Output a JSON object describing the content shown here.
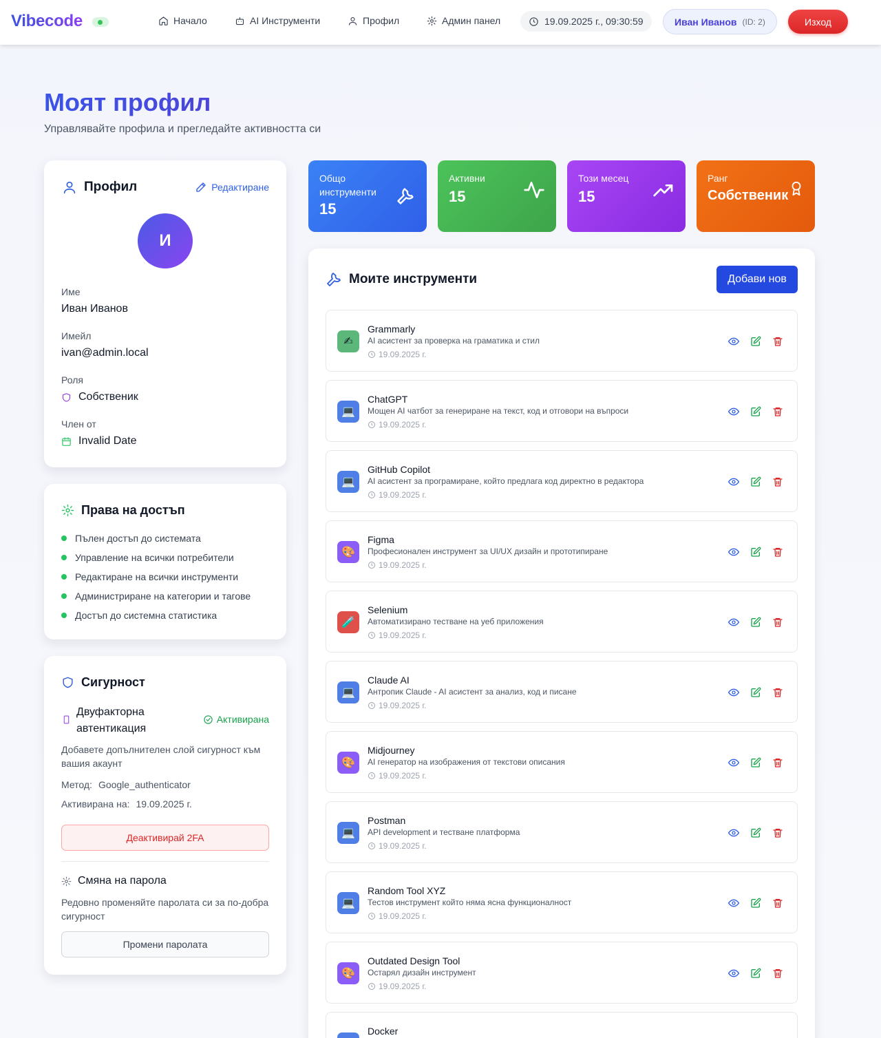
{
  "header": {
    "logo": "Vibecode",
    "nav": [
      {
        "label": "Начало",
        "icon": "home-icon"
      },
      {
        "label": "AI Инструменти",
        "icon": "robot-icon"
      },
      {
        "label": "Профил",
        "icon": "user-icon"
      },
      {
        "label": "Админ панел",
        "icon": "gear-icon"
      }
    ],
    "datetime": "19.09.2025 г., 09:30:59",
    "user_name": "Иван Иванов",
    "user_id": "(ID: 2)",
    "logout": "Изход"
  },
  "page": {
    "title": "Моят профил",
    "subtitle": "Управлявайте профила и прегледайте активността си"
  },
  "profile": {
    "title": "Профил",
    "edit": "Редактиране",
    "avatar_letter": "И",
    "name_label": "Име",
    "name": "Иван Иванов",
    "email_label": "Имейл",
    "email": "ivan@admin.local",
    "role_label": "Роля",
    "role": "Собственик",
    "member_label": "Член от",
    "member_since": "Invalid Date"
  },
  "permissions": {
    "title": "Права на достъп",
    "items": [
      "Пълен достъп до системата",
      "Управление на всички потребители",
      "Редактиране на всички инструменти",
      "Администриране на категории и тагове",
      "Достъп до системна статистика"
    ]
  },
  "security": {
    "title": "Сигурност",
    "twofa_title_line1": "Двуфакторна",
    "twofa_title_line2": "автентикация",
    "twofa_status": "Активирана",
    "twofa_desc": "Добавете допълнителен слой сигурност към вашия акаунт",
    "method_label": "Метод:",
    "method": "Google_authenticator",
    "activated_label": "Активирана на:",
    "activated": "19.09.2025 г.",
    "deactivate": "Деактивирай 2FA",
    "pw_title": "Смяна на парола",
    "pw_desc": "Редовно променяйте паролата си за по-добра сигурност",
    "pw_button": "Промени паролата"
  },
  "stats": [
    {
      "label": "Общо инструменти",
      "value": "15",
      "icon": "wrench-icon",
      "color": "#3b6ef6"
    },
    {
      "label": "Активни",
      "value": "15",
      "icon": "activity-icon",
      "color": "#45b553"
    },
    {
      "label": "Този месец",
      "value": "15",
      "icon": "trending-up-icon",
      "color": "#9b3cf0"
    },
    {
      "label": "Ранг",
      "value": "Собственик",
      "icon": "award-icon",
      "color": "#ef6a14"
    }
  ],
  "tools_section": {
    "title": "Моите инструменти",
    "add": "Добави нов",
    "tools": [
      {
        "name": "Grammarly",
        "desc": "AI асистент за проверка на граматика и стил",
        "date": "19.09.2025 г.",
        "icon": "✍",
        "icon_bg": "#5cb87a"
      },
      {
        "name": "ChatGPT",
        "desc": "Мощен AI чатбот за генериране на текст, код и отговори на въпроси",
        "date": "19.09.2025 г.",
        "icon": "💻",
        "icon_bg": "#4f7fe6"
      },
      {
        "name": "GitHub Copilot",
        "desc": "AI асистент за програмиране, който предлага код директно в редактора",
        "date": "19.09.2025 г.",
        "icon": "💻",
        "icon_bg": "#4f7fe6"
      },
      {
        "name": "Figma",
        "desc": "Професионален инструмент за UI/UX дизайн и прототипиране",
        "date": "19.09.2025 г.",
        "icon": "🎨",
        "icon_bg": "#8b5cf6"
      },
      {
        "name": "Selenium",
        "desc": "Автоматизирано тестване на уеб приложения",
        "date": "19.09.2025 г.",
        "icon": "🧪",
        "icon_bg": "#e0504a"
      },
      {
        "name": "Claude AI",
        "desc": "Антропик Claude - AI асистент за анализ, код и писане",
        "date": "19.09.2025 г.",
        "icon": "💻",
        "icon_bg": "#4f7fe6"
      },
      {
        "name": "Midjourney",
        "desc": "AI генератор на изображения от текстови описания",
        "date": "19.09.2025 г.",
        "icon": "🎨",
        "icon_bg": "#8b5cf6"
      },
      {
        "name": "Postman",
        "desc": "API development и тестване платформа",
        "date": "19.09.2025 г.",
        "icon": "💻",
        "icon_bg": "#4f7fe6"
      },
      {
        "name": "Random Tool XYZ",
        "desc": "Тестов инструмент който няма ясна функционалност",
        "date": "19.09.2025 г.",
        "icon": "💻",
        "icon_bg": "#4f7fe6"
      },
      {
        "name": "Outdated Design Tool",
        "desc": "Остарял дизайн инструмент",
        "date": "19.09.2025 г.",
        "icon": "🎨",
        "icon_bg": "#8b5cf6"
      },
      {
        "name": "Docker",
        "desc": "",
        "date": "",
        "icon": "⚙",
        "icon_bg": "#4f7fe6"
      }
    ]
  },
  "colors": {
    "primary": "#2f4de0",
    "success": "#22c55e",
    "danger": "#dc2626",
    "purple": "#7c3aed"
  }
}
